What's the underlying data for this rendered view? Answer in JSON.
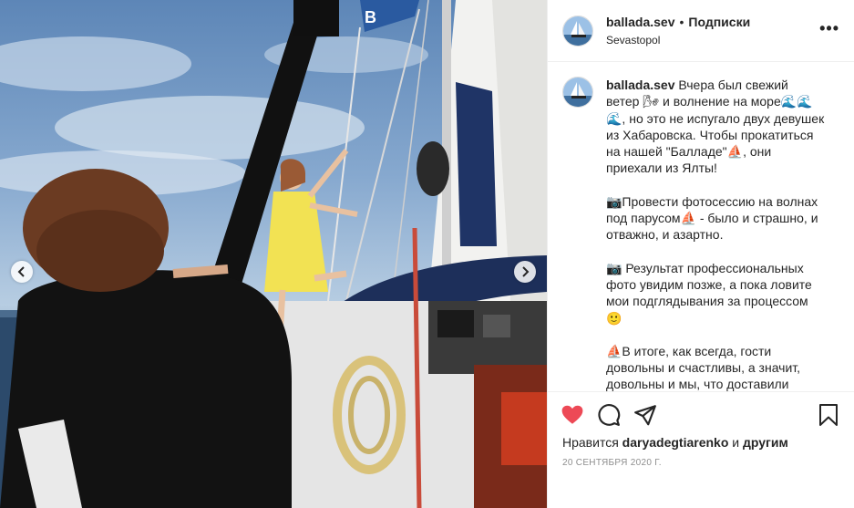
{
  "post": {
    "username": "ballada.sev",
    "separator": "•",
    "follow_label": "Подписки",
    "location": "Sevastopol",
    "more_label": "•••"
  },
  "caption": {
    "username": "ballada.sev",
    "paragraphs": [
      "Вчера был свежий ветер 🌬 и волнение на море🌊🌊🌊, но это не испугало двух девушек из Хабаровска. Чтобы прокатиться на нашей \"Балладе\"⛵, они приехали из Ялты!",
      "📷Провести фотосессию на волнах под парусом⛵ - было и страшно, и отважно, и азартно.",
      "📷 Результат профессиональных фото увидим позже, а пока ловите мои подглядывания за процессом 🙂",
      "⛵В итоге, как всегда, гости довольны и счастливы, а значит, довольны и мы, что доставили радость людям."
    ]
  },
  "likes": {
    "prefix": "Нравится",
    "user": "daryadegtiarenko",
    "middle": "и",
    "others": "другим"
  },
  "date": "20 СЕНТЯБРЯ 2020 Г.",
  "colors": {
    "like_red": "#ed4956",
    "text": "#262626",
    "muted": "#8e8e8e",
    "border": "#efefef"
  },
  "icons": [
    "heart-icon",
    "comment-icon",
    "share-icon",
    "bookmark-icon",
    "chevron-left-icon",
    "chevron-right-icon",
    "more-icon"
  ]
}
